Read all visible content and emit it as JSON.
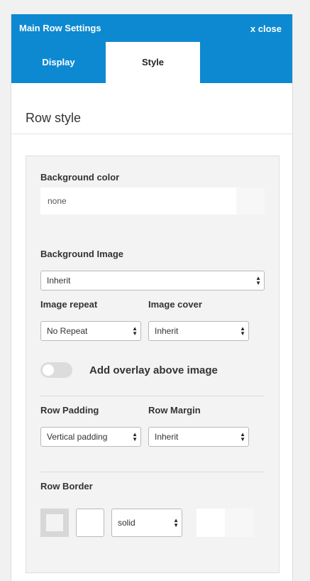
{
  "header": {
    "title": "Main Row Settings",
    "close_label": "x close"
  },
  "tabs": [
    {
      "label": "Display"
    },
    {
      "label": "Style"
    }
  ],
  "section": {
    "title": "Row style"
  },
  "background_color": {
    "label": "Background color",
    "value": "none"
  },
  "background_image": {
    "label": "Background Image",
    "selected": "Inherit"
  },
  "image_repeat": {
    "label": "Image repeat",
    "selected": "No Repeat"
  },
  "image_cover": {
    "label": "Image cover",
    "selected": "Inherit"
  },
  "overlay": {
    "label": "Add overlay above image",
    "enabled": false
  },
  "row_padding": {
    "label": "Row Padding",
    "selected": "Vertical padding"
  },
  "row_margin": {
    "label": "Row Margin",
    "selected": "Inherit"
  },
  "row_border": {
    "label": "Row Border",
    "style_selected": "solid"
  },
  "colors": {
    "accent": "#0d89d1",
    "panel_bg": "#ffffff",
    "inner_bg": "#f3f3f3",
    "page_bg": "#f1f1f1"
  }
}
